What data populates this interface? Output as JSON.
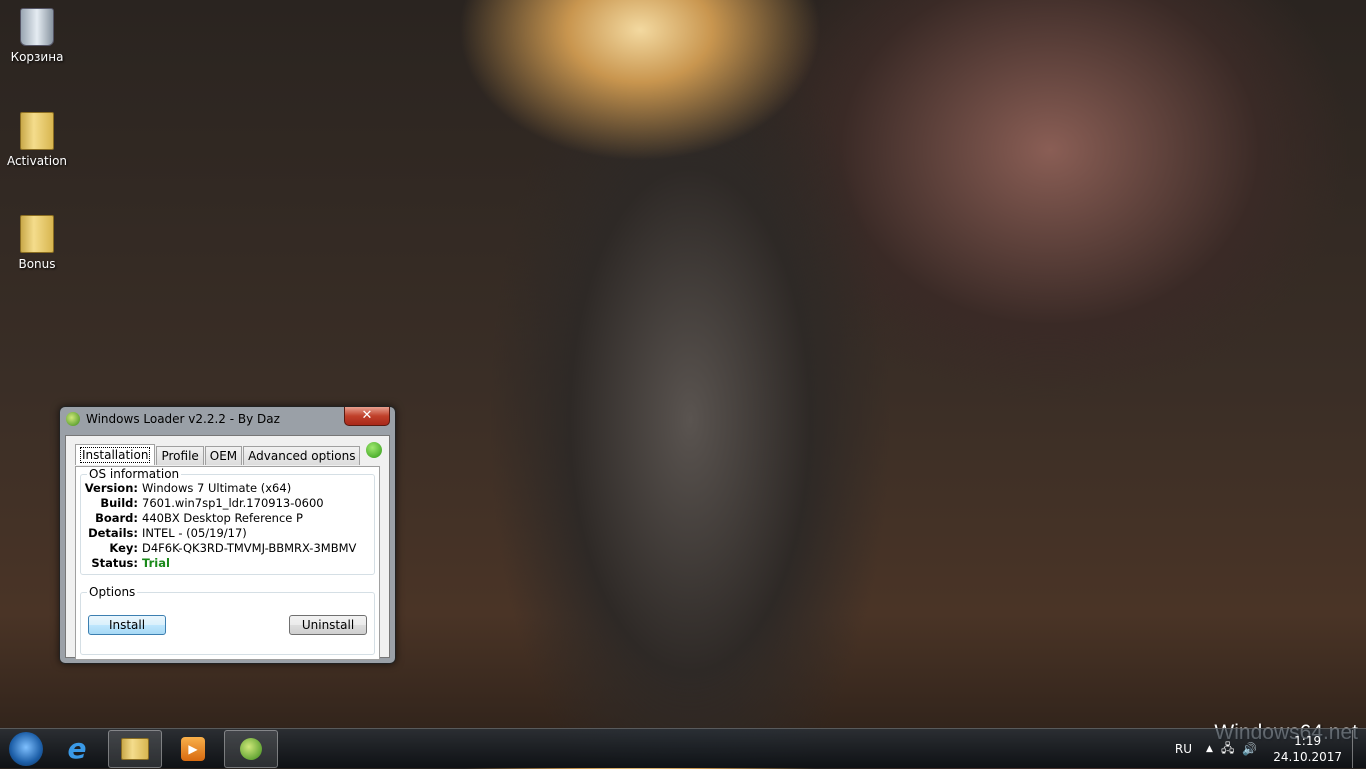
{
  "desktop": {
    "icons": [
      {
        "label": "Корзина",
        "icon": "recycle-bin-icon"
      },
      {
        "label": "Activation",
        "icon": "folder-icon"
      },
      {
        "label": "Bonus",
        "icon": "folder-icon"
      }
    ]
  },
  "window": {
    "title": "Windows Loader v2.2.2 - By Daz",
    "close": "✕",
    "tabs": [
      "Installation",
      "Profile",
      "OEM",
      "Advanced options"
    ],
    "os_info": {
      "legend": "OS information",
      "rows": [
        {
          "k": "Version:",
          "v": "Windows 7 Ultimate (x64)"
        },
        {
          "k": "Build:",
          "v": "7601.win7sp1_ldr.170913-0600"
        },
        {
          "k": "Board:",
          "v": "440BX Desktop Reference P"
        },
        {
          "k": "Details:",
          "v": "INTEL - (05/19/17)"
        },
        {
          "k": "Key:",
          "v": "D4F6K-QK3RD-TMVMJ-BBMRX-3MBMV"
        },
        {
          "k": "Status:",
          "v": "Trial"
        }
      ]
    },
    "options": {
      "legend": "Options",
      "install": "Install",
      "uninstall": "Uninstall"
    },
    "status_color": "#2f9a16"
  },
  "taskbar": {
    "lang": "RU",
    "time": "1:19",
    "date": "24.10.2017"
  },
  "watermark": "Windows64.net"
}
